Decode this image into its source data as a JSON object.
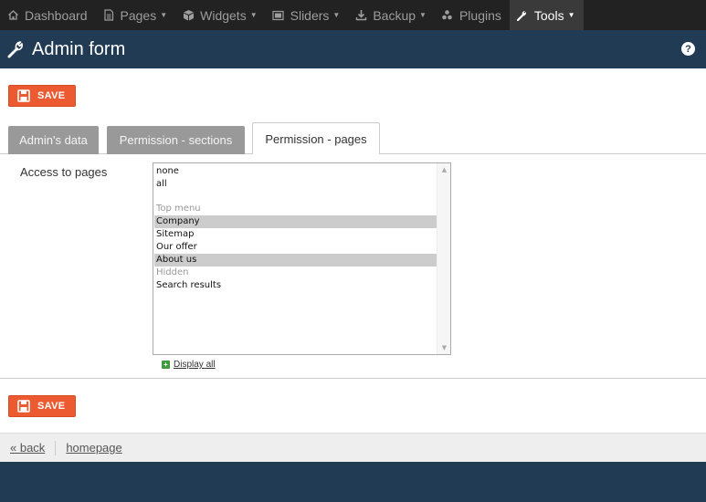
{
  "nav": {
    "items": [
      {
        "label": "Dashboard",
        "icon": "home-icon",
        "dropdown": false
      },
      {
        "label": "Pages",
        "icon": "page-icon",
        "dropdown": true
      },
      {
        "label": "Widgets",
        "icon": "cube-icon",
        "dropdown": true
      },
      {
        "label": "Sliders",
        "icon": "image-icon",
        "dropdown": true
      },
      {
        "label": "Backup",
        "icon": "download-icon",
        "dropdown": true
      },
      {
        "label": "Plugins",
        "icon": "puzzle-icon",
        "dropdown": false
      },
      {
        "label": "Tools",
        "icon": "wrench-icon",
        "dropdown": true,
        "active": true
      }
    ]
  },
  "header": {
    "title": "Admin form",
    "help": "?"
  },
  "save_label": "SAVE",
  "tabs": [
    {
      "label": "Admin's data",
      "active": false
    },
    {
      "label": "Permission - sections",
      "active": false
    },
    {
      "label": "Permission - pages",
      "active": true
    }
  ],
  "form": {
    "access_label": "Access to pages",
    "options": [
      {
        "label": "none",
        "type": "option",
        "selected": false
      },
      {
        "label": "all",
        "type": "option",
        "selected": false
      },
      {
        "label": "Top menu",
        "type": "group"
      },
      {
        "label": "Company",
        "type": "option",
        "selected": true
      },
      {
        "label": "Sitemap",
        "type": "option",
        "selected": false
      },
      {
        "label": "Our offer",
        "type": "option",
        "selected": false
      },
      {
        "label": "About us",
        "type": "option",
        "selected": true
      },
      {
        "label": "Hidden",
        "type": "group"
      },
      {
        "label": "Search results",
        "type": "option",
        "selected": false
      }
    ],
    "display_all": "Display all"
  },
  "links": {
    "back": "« back",
    "homepage": "homepage"
  },
  "colors": {
    "navbar": "#222222",
    "header": "#213b55",
    "save": "#ec5a31",
    "tab_inactive": "#999999",
    "selected": "#cccccc"
  }
}
